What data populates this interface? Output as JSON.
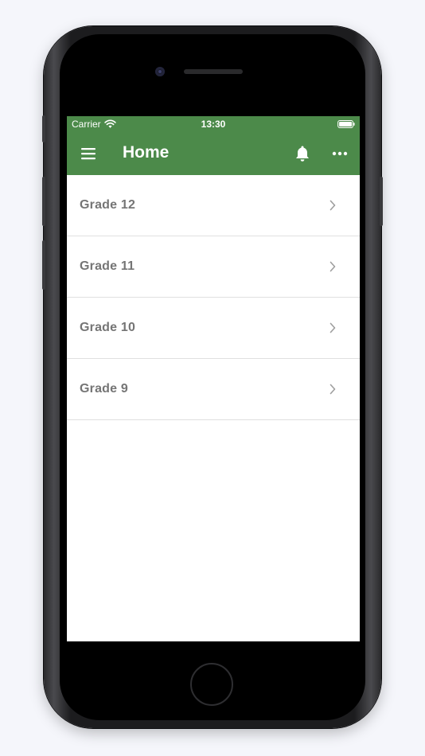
{
  "status_bar": {
    "carrier": "Carrier",
    "time": "13:30",
    "wifi_icon": "wifi-icon",
    "battery_icon": "battery-icon"
  },
  "app_bar": {
    "title": "Home",
    "menu_icon": "hamburger-menu-icon",
    "bell_icon": "bell-icon",
    "more_icon": "more-horizontal-icon",
    "color": "#4c8a4a"
  },
  "grades": [
    {
      "label": "Grade 12"
    },
    {
      "label": "Grade 11"
    },
    {
      "label": "Grade 10"
    },
    {
      "label": "Grade 9"
    }
  ],
  "colors": {
    "accent": "#4c8a4a",
    "list_text": "#757575",
    "divider": "#e0e0e0"
  }
}
